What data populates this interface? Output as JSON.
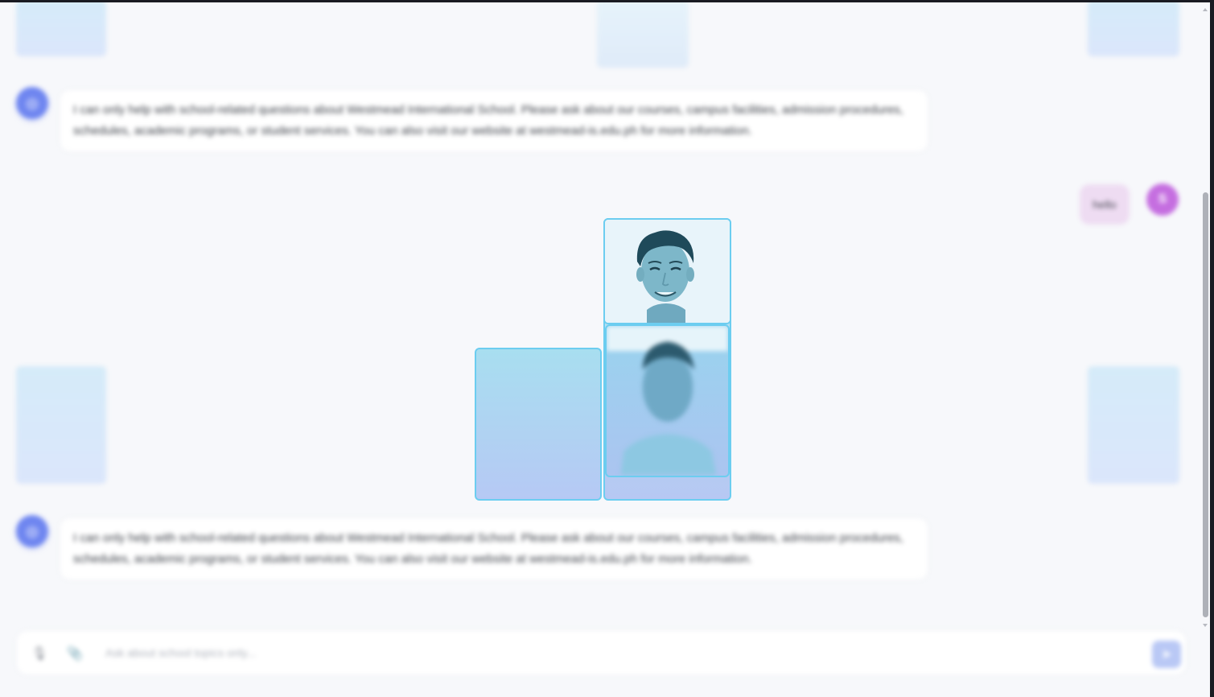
{
  "chat": {
    "messages": [
      {
        "role": "bot",
        "text": "I can only help with school-related questions about Westmead International School. Please ask about our courses, campus facilities, admission procedures, schedules, academic programs, or student services. You can also visit our website at westmead-is.edu.ph for more information."
      },
      {
        "role": "user",
        "text": "hello",
        "avatar_letter": "S"
      },
      {
        "role": "bot",
        "text": "I can only help with school-related questions about Westmead International School. Please ask about our courses, campus facilities, admission procedures, schedules, academic programs, or student services. You can also visit our website at westmead-is.edu.ph for more information."
      }
    ]
  },
  "input": {
    "placeholder": "Ask about school topics only..."
  },
  "icons": {
    "bot_avatar": "robot-icon",
    "voice": "microphone-icon",
    "attach": "paperclip-icon",
    "send": "send-icon"
  },
  "colors": {
    "accent": "#6f86f0",
    "user_avatar": "#c56ee0",
    "user_bubble": "#eedcf2",
    "tile_border": "#6ccdf0"
  }
}
